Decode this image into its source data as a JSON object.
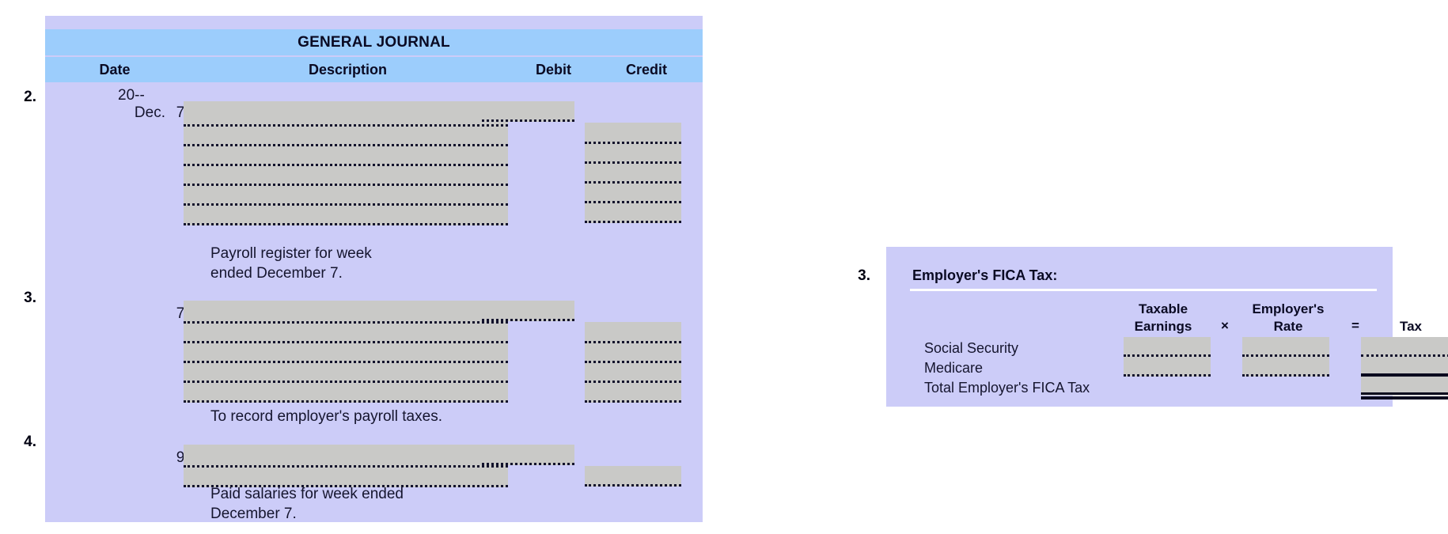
{
  "journal": {
    "title": "GENERAL JOURNAL",
    "columns": {
      "date": "Date",
      "description": "Description",
      "debit": "Debit",
      "credit": "Credit"
    },
    "year": "20--",
    "entries": [
      {
        "number": "2.",
        "month": "Dec.",
        "day": "7",
        "description_lines": 6,
        "debit_lines": 1,
        "credit_lines": 5,
        "memo": "Payroll register for week\nended December 7."
      },
      {
        "number": "3.",
        "month": "",
        "day": "7",
        "description_lines": 5,
        "debit_lines": 1,
        "credit_lines": 4,
        "memo": "To record employer's payroll taxes."
      },
      {
        "number": "4.",
        "month": "",
        "day": "9",
        "description_lines": 2,
        "debit_lines": 1,
        "credit_lines": 1,
        "memo": "Paid salaries for week ended\nDecember 7."
      }
    ]
  },
  "fica": {
    "number": "3.",
    "title": "Employer's FICA Tax:",
    "headers": {
      "taxable_earnings": "Taxable\nEarnings",
      "multiply": "×",
      "employers_rate": "Employer's\nRate",
      "equals": "=",
      "tax": "Tax"
    },
    "rows": [
      {
        "label": "Social Security"
      },
      {
        "label": "Medicare"
      },
      {
        "label": "Total Employer's FICA Tax"
      }
    ]
  },
  "colors": {
    "panel_background": "#ccccf8",
    "header_band": "#9ccdfc",
    "input_field": "#c9c9c7",
    "text": "#15152e",
    "rule": "#0a0a1e",
    "page_background": "#ffffff"
  }
}
